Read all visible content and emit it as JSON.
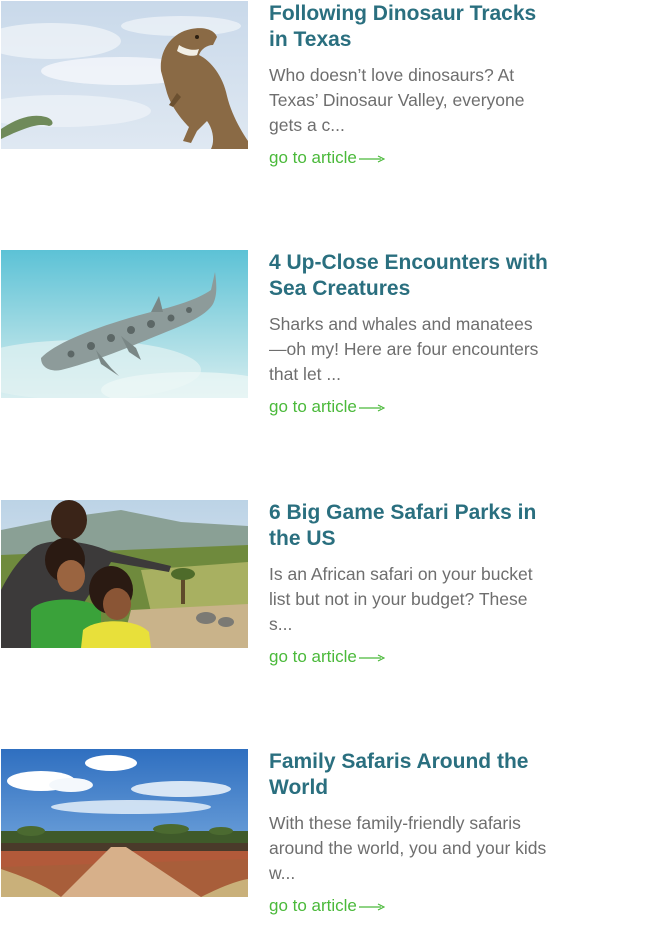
{
  "articles": [
    {
      "title": "Following Dinosaur Tracks in Texas",
      "excerpt": "Who doesn’t love dinosaurs? At Texas’ Dinosaur Valley, everyone gets a c...",
      "link_label": "go to article",
      "image": "dinosaur-statues-photo"
    },
    {
      "title": "4 Up-Close Encounters with Sea Creatures",
      "excerpt": "Sharks and whales and manatees—oh my! Here are four encounters that let ...",
      "link_label": "go to article",
      "image": "leopard-shark-photo"
    },
    {
      "title": "6 Big Game Safari Parks in the US",
      "excerpt": "Is an African safari on your bucket list but not in your budget? These s...",
      "link_label": "go to article",
      "image": "family-at-safari-park-photo"
    },
    {
      "title": "Family Safaris Around the World",
      "excerpt": "With these family-friendly safaris around the world, you and your kids w...",
      "link_label": "go to article",
      "image": "savanna-road-herd-photo"
    }
  ],
  "colors": {
    "title": "#2a6f7f",
    "excerpt": "#6e6e6e",
    "link": "#4ab93a"
  },
  "icons": {
    "link_arrow": "long-right-arrow-icon"
  }
}
